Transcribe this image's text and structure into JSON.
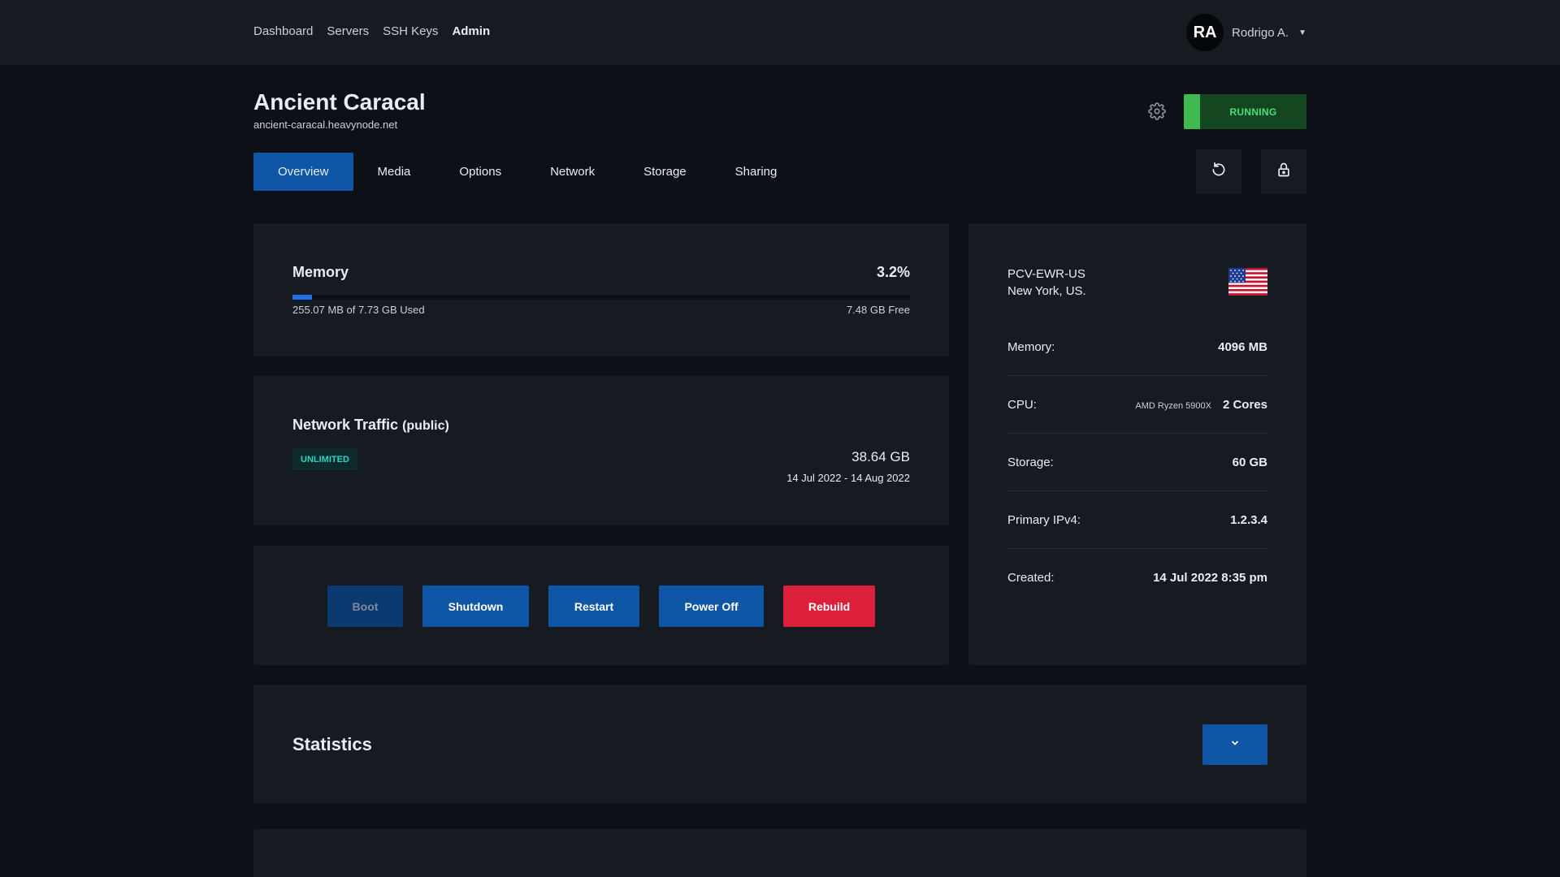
{
  "nav": {
    "items": [
      "Dashboard",
      "Servers",
      "SSH Keys",
      "Admin"
    ],
    "active": "Admin"
  },
  "user": {
    "initials": "RA",
    "name": "Rodrigo A."
  },
  "server": {
    "name": "Ancient Caracal",
    "hostname": "ancient-caracal.heavynode.net",
    "status": "RUNNING"
  },
  "tabs": [
    {
      "label": "Overview",
      "active": true
    },
    {
      "label": "Media"
    },
    {
      "label": "Options"
    },
    {
      "label": "Network"
    },
    {
      "label": "Storage"
    },
    {
      "label": "Sharing"
    }
  ],
  "memory": {
    "title": "Memory",
    "percent": "3.2%",
    "percent_value": 3.2,
    "used": "255.07 MB of 7.73 GB Used",
    "free": "7.48 GB Free"
  },
  "network": {
    "title": "Network Traffic",
    "subtitle": "(public)",
    "badge": "UNLIMITED",
    "amount": "38.64 GB",
    "range": "14 Jul 2022 - 14 Aug 2022"
  },
  "power": {
    "boot": "Boot",
    "shutdown": "Shutdown",
    "restart": "Restart",
    "power_off": "Power Off",
    "rebuild": "Rebuild"
  },
  "location": {
    "code": "PCV-EWR-US",
    "city": "New York, US."
  },
  "specs": [
    {
      "label": "Memory:",
      "value": "4096 MB"
    },
    {
      "label": "CPU:",
      "model": "AMD Ryzen 5900X",
      "value": "2 Cores"
    },
    {
      "label": "Storage:",
      "value": "60 GB"
    },
    {
      "label": "Primary IPv4:",
      "value": "1.2.3.4"
    },
    {
      "label": "Created:",
      "value": "14 Jul 2022 8:35 pm"
    }
  ],
  "statistics": {
    "title": "Statistics"
  },
  "icons": {
    "settings": "gear-icon",
    "refresh": "refresh-icon",
    "lock": "lock-icon",
    "toggle": "chevron-down-icon",
    "caret": "caret-down-icon",
    "flag": "us-flag-icon"
  },
  "colors": {
    "background": "#0d1117",
    "panel": "#161b22",
    "accent": "#0f56a6",
    "running": "#3fb950",
    "danger": "#dc1f3a",
    "badge": "#2dd4bf"
  }
}
